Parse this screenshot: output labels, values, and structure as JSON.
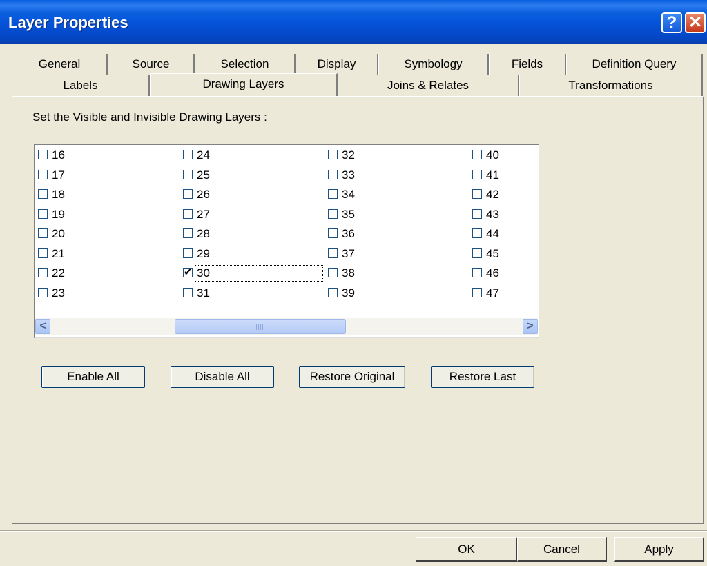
{
  "window": {
    "title": "Layer Properties",
    "help": "?",
    "close": "✕"
  },
  "tabs_row1": [
    "General",
    "Source",
    "Selection",
    "Display",
    "Symbology",
    "Fields",
    "Definition Query"
  ],
  "tabs_row2": [
    "Labels",
    "Drawing Layers",
    "Joins & Relates",
    "Transformations"
  ],
  "active_tab": "Drawing Layers",
  "instruction": "Set the Visible and  Invisible Drawing  Layers :",
  "layers": [
    {
      "label": "16",
      "checked": false
    },
    {
      "label": "17",
      "checked": false
    },
    {
      "label": "18",
      "checked": false
    },
    {
      "label": "19",
      "checked": false
    },
    {
      "label": "20",
      "checked": false
    },
    {
      "label": "21",
      "checked": false
    },
    {
      "label": "22",
      "checked": false
    },
    {
      "label": "23",
      "checked": false
    },
    {
      "label": "24",
      "checked": false
    },
    {
      "label": "25",
      "checked": false
    },
    {
      "label": "26",
      "checked": false
    },
    {
      "label": "27",
      "checked": false
    },
    {
      "label": "28",
      "checked": false
    },
    {
      "label": "29",
      "checked": false
    },
    {
      "label": "30",
      "checked": true
    },
    {
      "label": "31",
      "checked": false
    },
    {
      "label": "32",
      "checked": false
    },
    {
      "label": "33",
      "checked": false
    },
    {
      "label": "34",
      "checked": false
    },
    {
      "label": "35",
      "checked": false
    },
    {
      "label": "36",
      "checked": false
    },
    {
      "label": "37",
      "checked": false
    },
    {
      "label": "38",
      "checked": false
    },
    {
      "label": "39",
      "checked": false
    },
    {
      "label": "40",
      "checked": false
    },
    {
      "label": "41",
      "checked": false
    },
    {
      "label": "42",
      "checked": false
    },
    {
      "label": "43",
      "checked": false
    },
    {
      "label": "44",
      "checked": false
    },
    {
      "label": "45",
      "checked": false
    },
    {
      "label": "46",
      "checked": false
    },
    {
      "label": "47",
      "checked": false
    }
  ],
  "focused_layer": "30",
  "actions": {
    "enable_all": "Enable All",
    "disable_all": "Disable All",
    "restore_original": "Restore Original",
    "restore_last": "Restore Last"
  },
  "footer": {
    "ok": "OK",
    "cancel": "Cancel",
    "apply": "Apply"
  },
  "scrollbar": {
    "left_icon": "scroll-left-arrow",
    "right_icon": "scroll-right-arrow",
    "glyph_left": "<",
    "glyph_right": ">"
  }
}
